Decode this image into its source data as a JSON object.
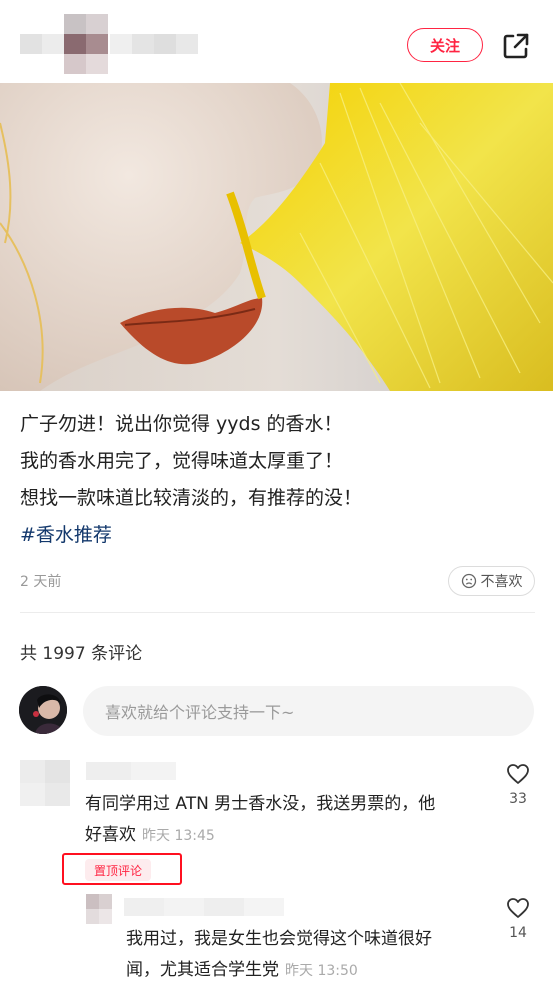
{
  "header": {
    "follow_label": "关注",
    "share_icon": "share-icon"
  },
  "post": {
    "lines": [
      "广子勿进！说出你觉得 yyds 的香水！",
      "我的香水用完了，觉得味道太厚重了！",
      "想找一款味道比较清淡的，有推荐的没！"
    ],
    "hashtag": "#香水推荐",
    "time": "2 天前",
    "dislike_label": "不喜欢"
  },
  "comments_section": {
    "count_label": "共 1997 条评论",
    "input_placeholder": "喜欢就给个评论支持一下~"
  },
  "comments": [
    {
      "line1": "有同学用过 ATN 男士香水没，我送男票的，他",
      "line2": "好喜欢",
      "time": "昨天 13:45",
      "likes": "33",
      "pinned_label": "置顶评论"
    },
    {
      "line1": "我用过，我是女生也会觉得这个味道很好",
      "line2": "闻，尤其适合学生党",
      "time": "昨天 13:50",
      "likes": "14"
    }
  ],
  "colors": {
    "accent": "#ff2442",
    "hashtag": "#13386c",
    "pin_box": "#ff1020"
  }
}
